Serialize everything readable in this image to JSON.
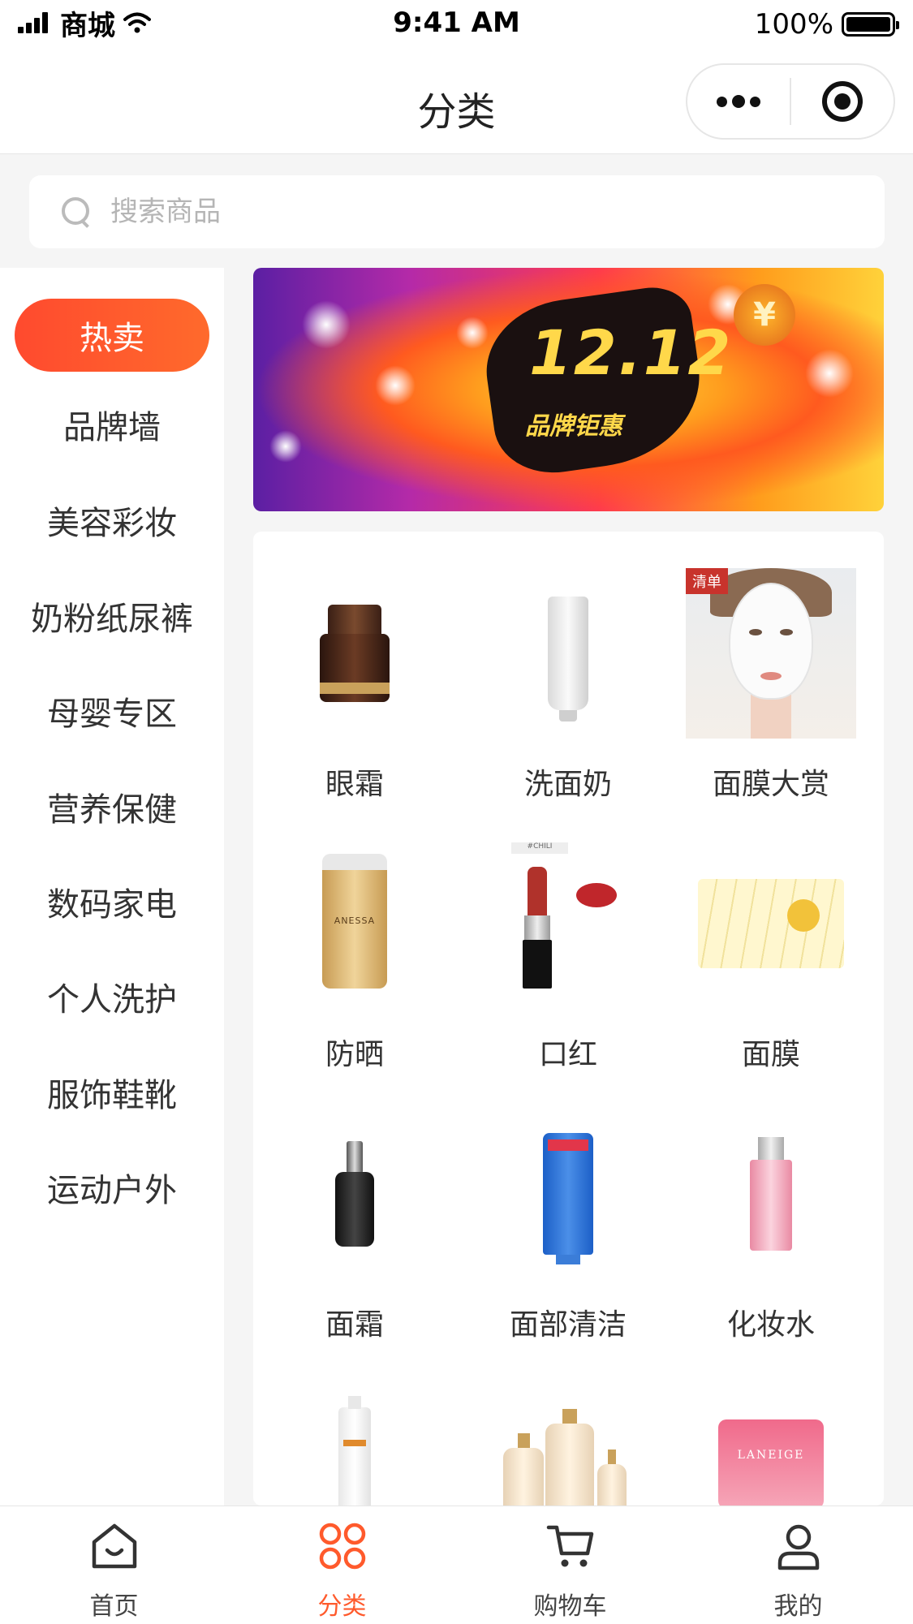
{
  "status_bar": {
    "carrier": "商城",
    "time": "9:41 AM",
    "battery": "100%"
  },
  "nav": {
    "title": "分类"
  },
  "search": {
    "placeholder": "搜索商品"
  },
  "sidebar": {
    "items": [
      {
        "label": "热卖",
        "active": true
      },
      {
        "label": "品牌墙"
      },
      {
        "label": "美容彩妆"
      },
      {
        "label": "奶粉纸尿裤"
      },
      {
        "label": "母婴专区"
      },
      {
        "label": "营养保健"
      },
      {
        "label": "数码家电"
      },
      {
        "label": "个人洗护"
      },
      {
        "label": "服饰鞋靴"
      },
      {
        "label": "运动户外"
      }
    ]
  },
  "banner": {
    "title": "12.12",
    "subtitle": "品牌钜惠",
    "coin": "¥"
  },
  "categories": [
    {
      "label": "眼霜",
      "icon": "eye-cream-jar"
    },
    {
      "label": "洗面奶",
      "icon": "cleanser-tube"
    },
    {
      "label": "面膜大赏",
      "icon": "face-mask-model",
      "badge": "清单"
    },
    {
      "label": "防晒",
      "icon": "sunscreen-bottle",
      "brand": "ANESSA"
    },
    {
      "label": "口红",
      "icon": "lipstick",
      "tag": "#CHILI"
    },
    {
      "label": "面膜",
      "icon": "sheet-masks"
    },
    {
      "label": "面霜",
      "icon": "serum-bottle"
    },
    {
      "label": "面部清洁",
      "icon": "blue-cleanser-tube"
    },
    {
      "label": "化妆水",
      "icon": "toner-bottle"
    },
    {
      "label": "",
      "icon": "spray-bottle"
    },
    {
      "label": "",
      "icon": "skincare-set"
    },
    {
      "label": "",
      "icon": "laneige-jar",
      "brand": "LANEIGE"
    }
  ],
  "tabs": [
    {
      "label": "首页",
      "icon": "home-icon"
    },
    {
      "label": "分类",
      "icon": "category-icon",
      "active": true
    },
    {
      "label": "购物车",
      "icon": "cart-icon"
    },
    {
      "label": "我的",
      "icon": "user-icon"
    }
  ],
  "colors": {
    "accent": "#ff5a2c",
    "accent_gradient_start": "#ff4a2e",
    "text": "#333333",
    "background": "#f5f5f5"
  }
}
